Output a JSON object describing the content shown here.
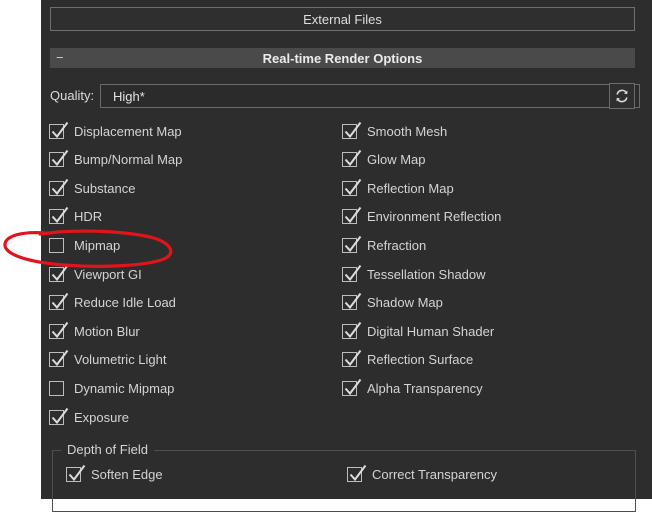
{
  "external_files": {
    "label": "External Files"
  },
  "section": {
    "collapse_symbol": "−",
    "title": "Real-time Render Options"
  },
  "quality": {
    "label": "Quality:",
    "value": "High*",
    "refresh_icon": "refresh-icon"
  },
  "options_left": [
    {
      "label": "Displacement Map",
      "checked": true
    },
    {
      "label": "Bump/Normal Map",
      "checked": true
    },
    {
      "label": "Substance",
      "checked": true
    },
    {
      "label": "HDR",
      "checked": true
    },
    {
      "label": "Mipmap",
      "checked": false
    },
    {
      "label": "Viewport GI",
      "checked": true
    },
    {
      "label": "Reduce Idle Load",
      "checked": true
    },
    {
      "label": "Motion Blur",
      "checked": true
    },
    {
      "label": "Volumetric Light",
      "checked": true
    },
    {
      "label": "Dynamic Mipmap",
      "checked": false
    },
    {
      "label": "Exposure",
      "checked": true
    }
  ],
  "options_right": [
    {
      "label": "Smooth Mesh",
      "checked": true
    },
    {
      "label": "Glow Map",
      "checked": true
    },
    {
      "label": "Reflection Map",
      "checked": true
    },
    {
      "label": "Environment Reflection",
      "checked": true
    },
    {
      "label": "Refraction",
      "checked": true
    },
    {
      "label": "Tessellation Shadow",
      "checked": true
    },
    {
      "label": "Shadow Map",
      "checked": true
    },
    {
      "label": "Digital Human Shader",
      "checked": true
    },
    {
      "label": "Reflection Surface",
      "checked": true
    },
    {
      "label": "Alpha Transparency",
      "checked": true
    }
  ],
  "depth_of_field": {
    "title": "Depth of Field",
    "options": [
      {
        "label": "Soften Edge",
        "checked": true
      },
      {
        "label": "Correct Transparency",
        "checked": true
      }
    ]
  },
  "colors": {
    "panel_bg": "#2d2d2d",
    "header_bg": "#4a4a4a",
    "annotation": "#e0141b"
  }
}
